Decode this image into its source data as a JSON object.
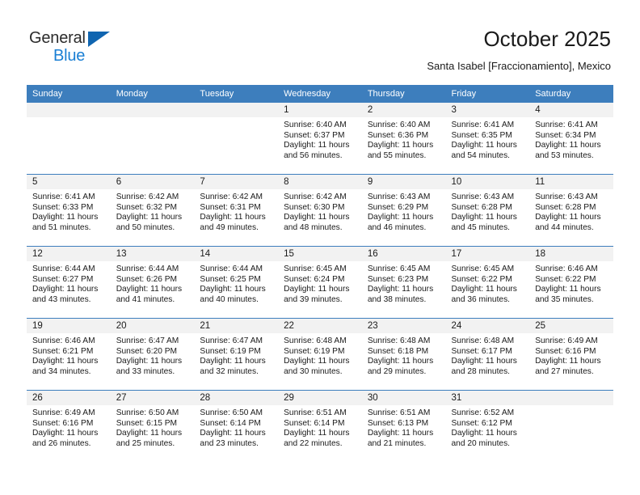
{
  "brand": {
    "name_part1": "General",
    "name_part2": "Blue",
    "triangle_color": "#1065b0",
    "blue_color": "#1a7fd4"
  },
  "header": {
    "title": "October 2025",
    "subtitle": "Santa Isabel [Fraccionamiento], Mexico"
  },
  "theme": {
    "header_blue": "#3d7ebd",
    "daynum_band": "#f2f2f2"
  },
  "calendar": {
    "weekday_headers": [
      "Sunday",
      "Monday",
      "Tuesday",
      "Wednesday",
      "Thursday",
      "Friday",
      "Saturday"
    ],
    "weeks": [
      [
        {
          "day": "",
          "empty": true
        },
        {
          "day": "",
          "empty": true
        },
        {
          "day": "",
          "empty": true
        },
        {
          "day": "1",
          "sunrise": "Sunrise: 6:40 AM",
          "sunset": "Sunset: 6:37 PM",
          "daylight": "Daylight: 11 hours and 56 minutes."
        },
        {
          "day": "2",
          "sunrise": "Sunrise: 6:40 AM",
          "sunset": "Sunset: 6:36 PM",
          "daylight": "Daylight: 11 hours and 55 minutes."
        },
        {
          "day": "3",
          "sunrise": "Sunrise: 6:41 AM",
          "sunset": "Sunset: 6:35 PM",
          "daylight": "Daylight: 11 hours and 54 minutes."
        },
        {
          "day": "4",
          "sunrise": "Sunrise: 6:41 AM",
          "sunset": "Sunset: 6:34 PM",
          "daylight": "Daylight: 11 hours and 53 minutes."
        }
      ],
      [
        {
          "day": "5",
          "sunrise": "Sunrise: 6:41 AM",
          "sunset": "Sunset: 6:33 PM",
          "daylight": "Daylight: 11 hours and 51 minutes."
        },
        {
          "day": "6",
          "sunrise": "Sunrise: 6:42 AM",
          "sunset": "Sunset: 6:32 PM",
          "daylight": "Daylight: 11 hours and 50 minutes."
        },
        {
          "day": "7",
          "sunrise": "Sunrise: 6:42 AM",
          "sunset": "Sunset: 6:31 PM",
          "daylight": "Daylight: 11 hours and 49 minutes."
        },
        {
          "day": "8",
          "sunrise": "Sunrise: 6:42 AM",
          "sunset": "Sunset: 6:30 PM",
          "daylight": "Daylight: 11 hours and 48 minutes."
        },
        {
          "day": "9",
          "sunrise": "Sunrise: 6:43 AM",
          "sunset": "Sunset: 6:29 PM",
          "daylight": "Daylight: 11 hours and 46 minutes."
        },
        {
          "day": "10",
          "sunrise": "Sunrise: 6:43 AM",
          "sunset": "Sunset: 6:28 PM",
          "daylight": "Daylight: 11 hours and 45 minutes."
        },
        {
          "day": "11",
          "sunrise": "Sunrise: 6:43 AM",
          "sunset": "Sunset: 6:28 PM",
          "daylight": "Daylight: 11 hours and 44 minutes."
        }
      ],
      [
        {
          "day": "12",
          "sunrise": "Sunrise: 6:44 AM",
          "sunset": "Sunset: 6:27 PM",
          "daylight": "Daylight: 11 hours and 43 minutes."
        },
        {
          "day": "13",
          "sunrise": "Sunrise: 6:44 AM",
          "sunset": "Sunset: 6:26 PM",
          "daylight": "Daylight: 11 hours and 41 minutes."
        },
        {
          "day": "14",
          "sunrise": "Sunrise: 6:44 AM",
          "sunset": "Sunset: 6:25 PM",
          "daylight": "Daylight: 11 hours and 40 minutes."
        },
        {
          "day": "15",
          "sunrise": "Sunrise: 6:45 AM",
          "sunset": "Sunset: 6:24 PM",
          "daylight": "Daylight: 11 hours and 39 minutes."
        },
        {
          "day": "16",
          "sunrise": "Sunrise: 6:45 AM",
          "sunset": "Sunset: 6:23 PM",
          "daylight": "Daylight: 11 hours and 38 minutes."
        },
        {
          "day": "17",
          "sunrise": "Sunrise: 6:45 AM",
          "sunset": "Sunset: 6:22 PM",
          "daylight": "Daylight: 11 hours and 36 minutes."
        },
        {
          "day": "18",
          "sunrise": "Sunrise: 6:46 AM",
          "sunset": "Sunset: 6:22 PM",
          "daylight": "Daylight: 11 hours and 35 minutes."
        }
      ],
      [
        {
          "day": "19",
          "sunrise": "Sunrise: 6:46 AM",
          "sunset": "Sunset: 6:21 PM",
          "daylight": "Daylight: 11 hours and 34 minutes."
        },
        {
          "day": "20",
          "sunrise": "Sunrise: 6:47 AM",
          "sunset": "Sunset: 6:20 PM",
          "daylight": "Daylight: 11 hours and 33 minutes."
        },
        {
          "day": "21",
          "sunrise": "Sunrise: 6:47 AM",
          "sunset": "Sunset: 6:19 PM",
          "daylight": "Daylight: 11 hours and 32 minutes."
        },
        {
          "day": "22",
          "sunrise": "Sunrise: 6:48 AM",
          "sunset": "Sunset: 6:19 PM",
          "daylight": "Daylight: 11 hours and 30 minutes."
        },
        {
          "day": "23",
          "sunrise": "Sunrise: 6:48 AM",
          "sunset": "Sunset: 6:18 PM",
          "daylight": "Daylight: 11 hours and 29 minutes."
        },
        {
          "day": "24",
          "sunrise": "Sunrise: 6:48 AM",
          "sunset": "Sunset: 6:17 PM",
          "daylight": "Daylight: 11 hours and 28 minutes."
        },
        {
          "day": "25",
          "sunrise": "Sunrise: 6:49 AM",
          "sunset": "Sunset: 6:16 PM",
          "daylight": "Daylight: 11 hours and 27 minutes."
        }
      ],
      [
        {
          "day": "26",
          "sunrise": "Sunrise: 6:49 AM",
          "sunset": "Sunset: 6:16 PM",
          "daylight": "Daylight: 11 hours and 26 minutes."
        },
        {
          "day": "27",
          "sunrise": "Sunrise: 6:50 AM",
          "sunset": "Sunset: 6:15 PM",
          "daylight": "Daylight: 11 hours and 25 minutes."
        },
        {
          "day": "28",
          "sunrise": "Sunrise: 6:50 AM",
          "sunset": "Sunset: 6:14 PM",
          "daylight": "Daylight: 11 hours and 23 minutes."
        },
        {
          "day": "29",
          "sunrise": "Sunrise: 6:51 AM",
          "sunset": "Sunset: 6:14 PM",
          "daylight": "Daylight: 11 hours and 22 minutes."
        },
        {
          "day": "30",
          "sunrise": "Sunrise: 6:51 AM",
          "sunset": "Sunset: 6:13 PM",
          "daylight": "Daylight: 11 hours and 21 minutes."
        },
        {
          "day": "31",
          "sunrise": "Sunrise: 6:52 AM",
          "sunset": "Sunset: 6:12 PM",
          "daylight": "Daylight: 11 hours and 20 minutes."
        },
        {
          "day": "",
          "empty": true
        }
      ]
    ]
  }
}
